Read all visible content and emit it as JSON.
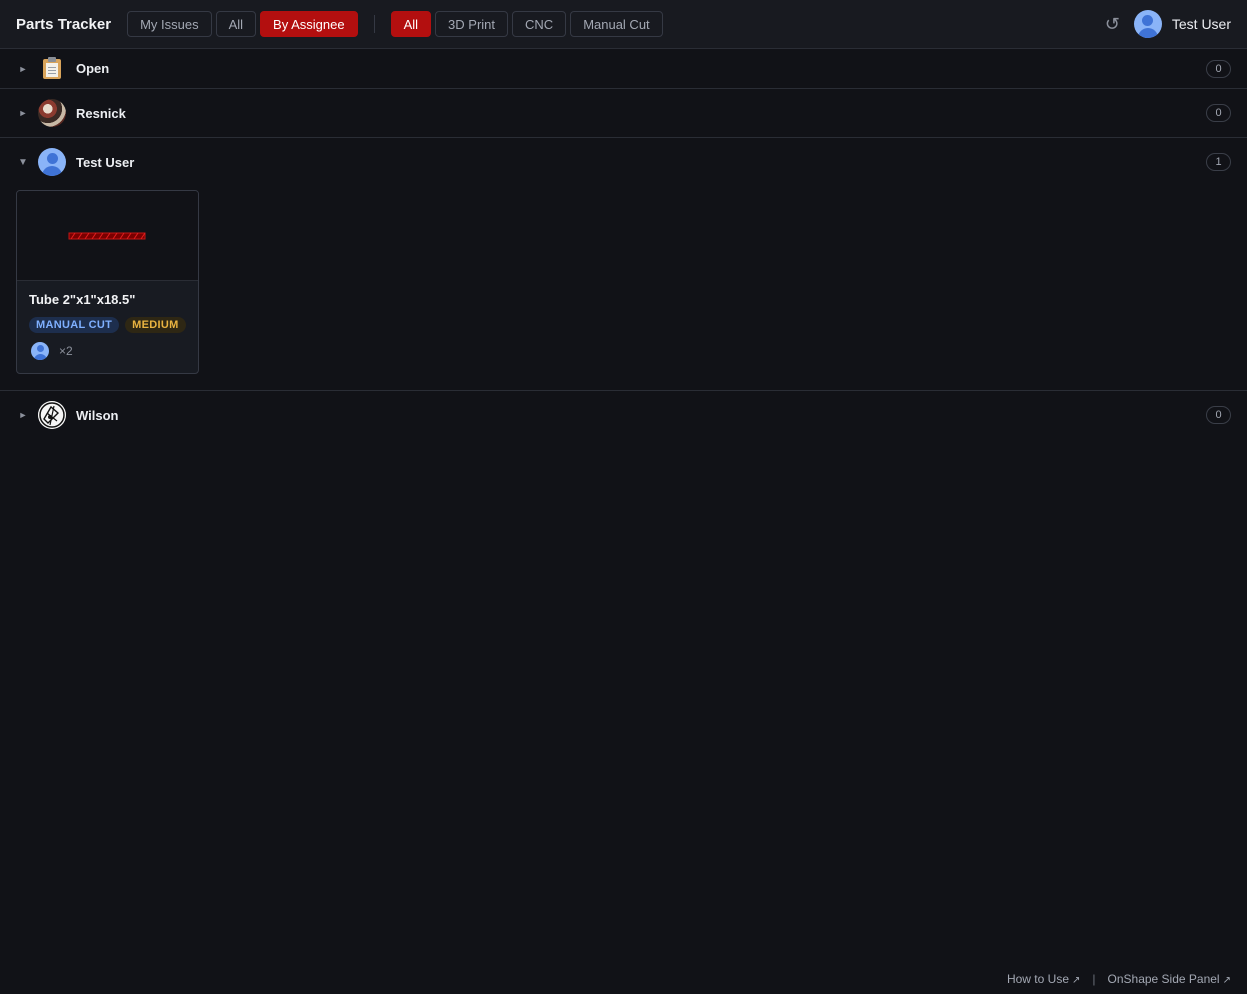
{
  "app": {
    "title": "Parts Tracker"
  },
  "view_tabs": [
    {
      "label": "My Issues",
      "active": false
    },
    {
      "label": "All",
      "active": false
    },
    {
      "label": "By Assignee",
      "active": true
    }
  ],
  "type_filters": [
    {
      "label": "All",
      "active": true
    },
    {
      "label": "3D Print",
      "active": false
    },
    {
      "label": "CNC",
      "active": false
    },
    {
      "label": "Manual Cut",
      "active": false
    }
  ],
  "header": {
    "refresh_glyph": "↺",
    "user_name": "Test User",
    "user_icon": "user-avatar-icon"
  },
  "groups": [
    {
      "name": "Open",
      "count": "0",
      "expanded": false,
      "icon": "clipboard-icon"
    },
    {
      "name": "Resnick",
      "count": "0",
      "expanded": false,
      "icon": "avatar-photo"
    },
    {
      "name": "Test User",
      "count": "1",
      "expanded": true,
      "icon": "user-avatar-icon"
    },
    {
      "name": "Wilson",
      "count": "0",
      "expanded": false,
      "icon": "avatar-photo"
    }
  ],
  "card": {
    "title": "Tube 2\"x1\"x18.5\"",
    "type_tag": "MANUAL CUT",
    "priority_tag": "MEDIUM",
    "quantity": "×2"
  },
  "carets": {
    "collapsed": "►",
    "expanded": "▼"
  },
  "footer": {
    "how_to_use": "How to Use",
    "ext_glyph": "↗",
    "separator": "|",
    "side_panel": "OnShape Side Panel"
  },
  "colors": {
    "accent": "#b30f0f",
    "background": "#111217",
    "type_tag": "#7fb0ff",
    "priority_tag": "#e9b341"
  }
}
